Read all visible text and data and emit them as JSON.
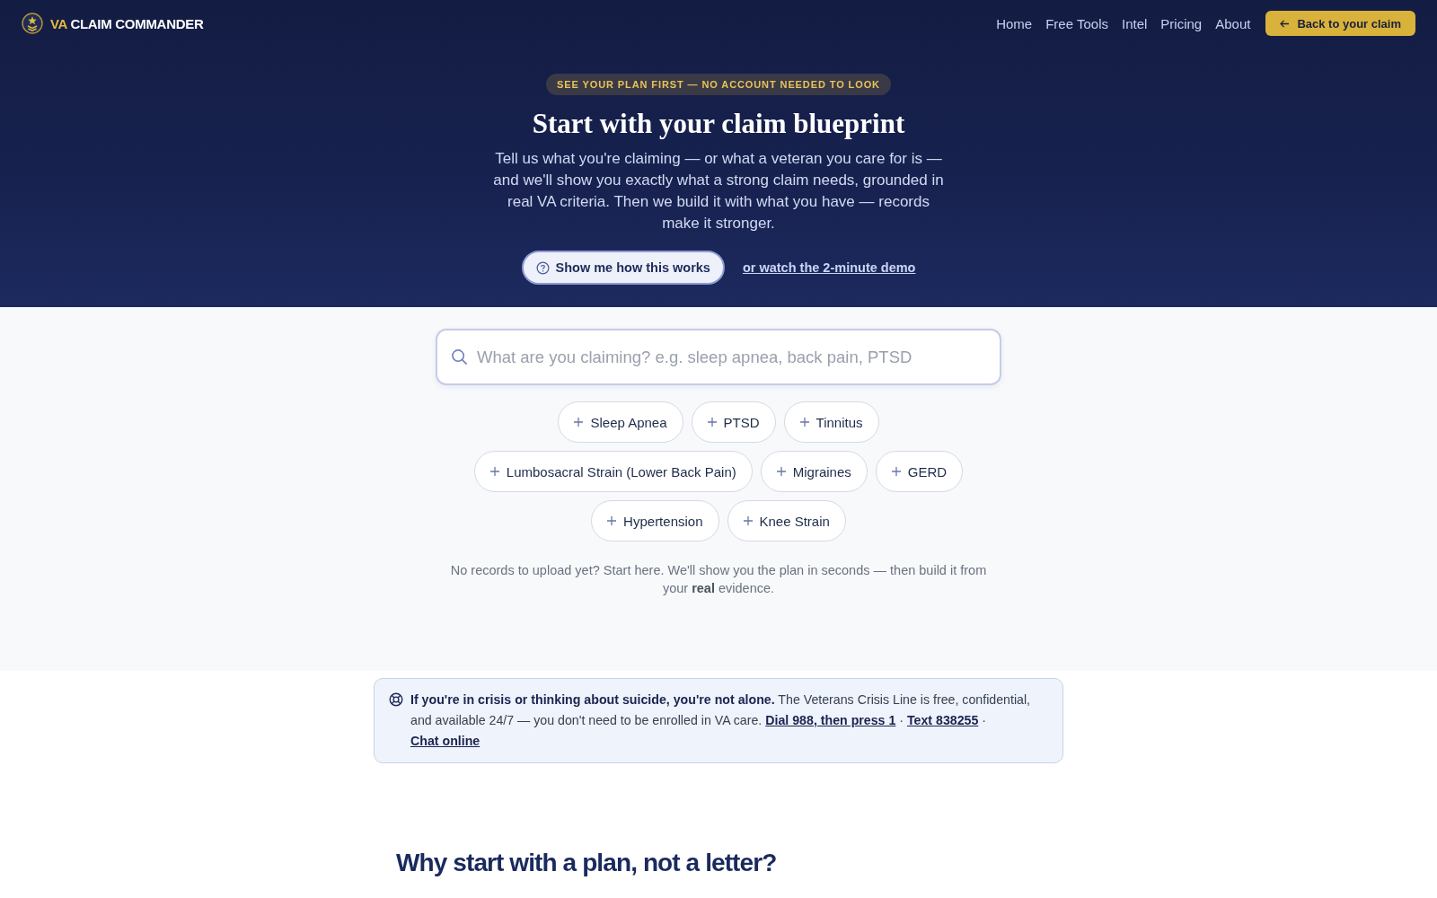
{
  "header": {
    "logo": {
      "accent": "VA",
      "name": "CLAIM COMMANDER"
    },
    "nav": [
      {
        "label": "Home"
      },
      {
        "label": "Free Tools"
      },
      {
        "label": "Intel"
      },
      {
        "label": "Pricing"
      },
      {
        "label": "About"
      }
    ],
    "back_button": {
      "label": "Back to your claim"
    }
  },
  "hero": {
    "badge": "SEE YOUR PLAN FIRST — NO ACCOUNT NEEDED TO LOOK",
    "title": "Start with your claim blueprint",
    "description": "Tell us what you're claiming — or what a veteran you care for is — and we'll show you exactly what a strong claim needs, grounded in real VA criteria. Then we build it with what you have — records make it stronger.",
    "primary_button": {
      "label": "Show me how this works"
    },
    "demo_link": {
      "label": "or watch the 2-minute demo"
    }
  },
  "search": {
    "placeholder": "What are you claiming? e.g. sleep apnea, back pain, PTSD"
  },
  "suggestions": [
    {
      "label": "Sleep Apnea"
    },
    {
      "label": "PTSD"
    },
    {
      "label": "Tinnitus"
    },
    {
      "label": "Lumbosacral Strain (Lower Back Pain)"
    },
    {
      "label": "Migraines"
    },
    {
      "label": "GERD"
    },
    {
      "label": "Hypertension"
    },
    {
      "label": "Knee Strain"
    }
  ],
  "note": "No records to upload yet? Start here. We'll show you the plan in seconds — then build it from your **real** evidence.",
  "crisis": {
    "lead": "If you're in crisis or thinking about suicide, you're not alone.",
    "text": "The Veterans Crisis Line is free, confidential, and available 24/7 — you don't need to be enrolled in VA care.",
    "links": [
      {
        "label": "Dial 988, then press 1"
      },
      {
        "label": "Text 838255"
      },
      {
        "label": "Chat online"
      }
    ],
    "separator": "·"
  },
  "section": {
    "title": "Why start with a plan, not a letter?"
  }
}
